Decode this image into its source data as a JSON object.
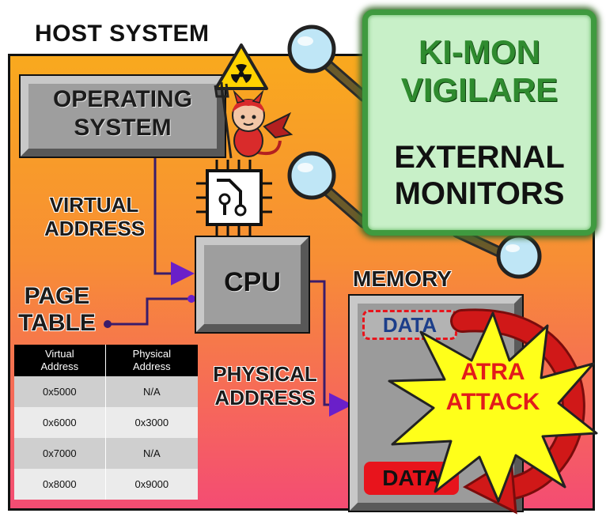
{
  "host_system": {
    "title": "HOST SYSTEM"
  },
  "operating_system": {
    "line1": "OPERATING",
    "line2": "SYSTEM"
  },
  "cpu": {
    "label": "CPU"
  },
  "virtual_address": {
    "line1": "VIRTUAL",
    "line2": "ADDRESS"
  },
  "physical_address": {
    "line1": "PHYSICAL",
    "line2": "ADDRESS"
  },
  "page_table": {
    "line1": "PAGE",
    "line2": "TABLE",
    "headers": [
      {
        "line1": "Virtual",
        "line2": "Address"
      },
      {
        "line1": "Physical",
        "line2": "Address"
      }
    ],
    "rows": [
      {
        "virtual": "0x5000",
        "physical": "N/A"
      },
      {
        "virtual": "0x6000",
        "physical": "0x3000"
      },
      {
        "virtual": "0x7000",
        "physical": "N/A"
      },
      {
        "virtual": "0x8000",
        "physical": "0x9000"
      }
    ]
  },
  "memory": {
    "title": "MEMORY",
    "data_original": "DATA",
    "data_moved": "DATA"
  },
  "attack": {
    "line1": "ATRA",
    "line2": "ATTACK"
  },
  "external_monitors": {
    "title_line1": "KI-MON",
    "title_line2": "VIGILARE",
    "label_line1": "EXTERNAL",
    "label_line2": "MONITORS"
  },
  "icons": [
    "radiation-hazard-icon",
    "devil-icon",
    "chip-icon",
    "magnifier-icon"
  ],
  "colors": {
    "host_gradient_top": "#f9a91e",
    "host_gradient_bottom": "#f44c73",
    "monitor_green": "#2f8b2f",
    "attack_red": "#e21b1b",
    "arrow_purple": "#6a1fc9",
    "burst_yellow": "#ffff1a"
  }
}
